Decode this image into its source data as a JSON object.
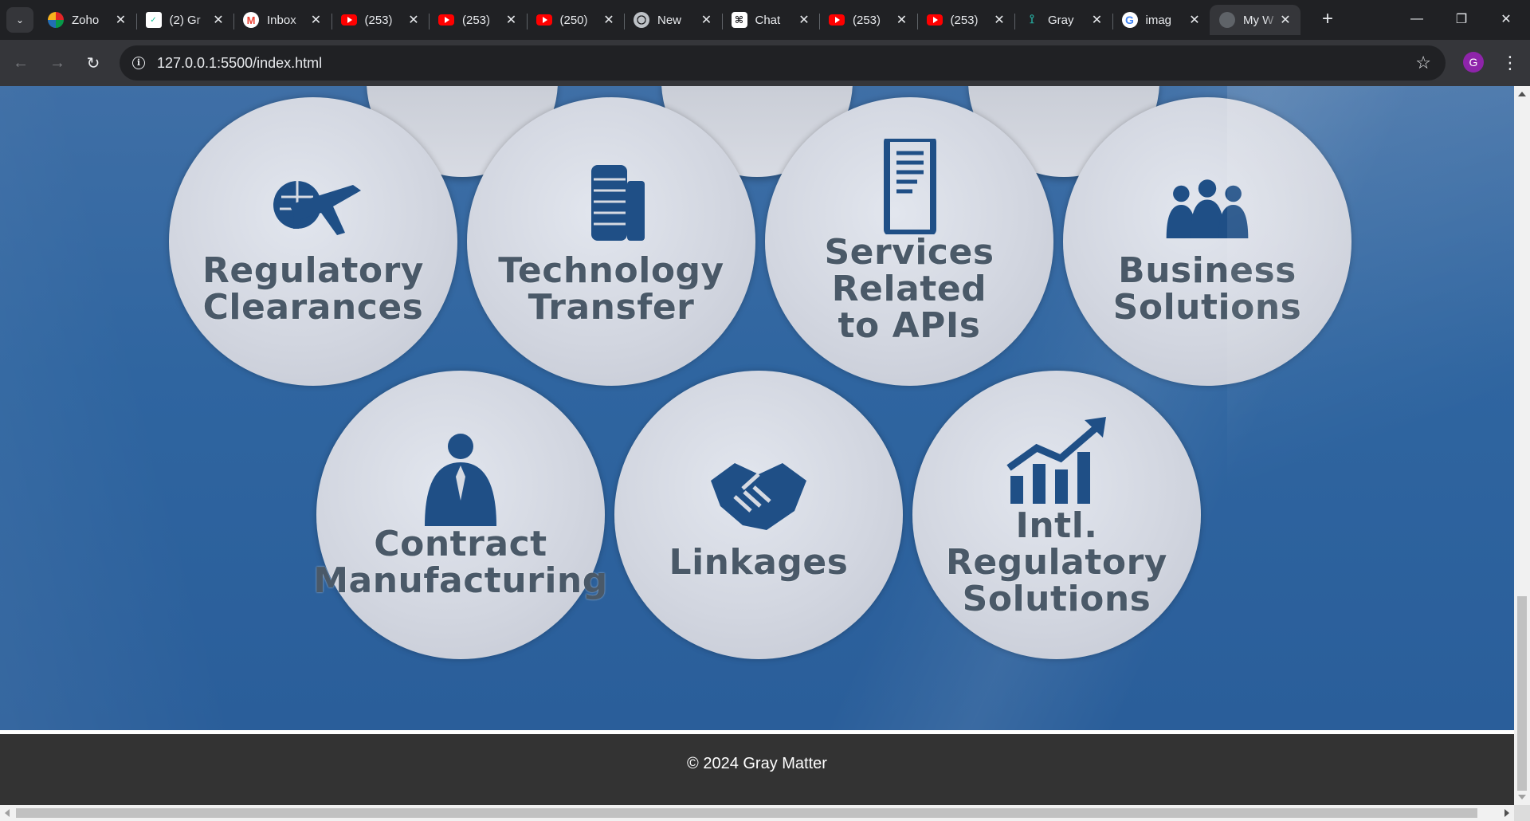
{
  "tabs": [
    {
      "title": "Zoho",
      "icon": "zoho-icon"
    },
    {
      "title": "(2) Gr",
      "icon": "grammarly-icon"
    },
    {
      "title": "Inbox",
      "icon": "gmail-icon"
    },
    {
      "title": "(253)",
      "icon": "youtube-icon"
    },
    {
      "title": "(253)",
      "icon": "youtube-icon"
    },
    {
      "title": "(250)",
      "icon": "youtube-icon"
    },
    {
      "title": "New",
      "icon": "chrome-icon"
    },
    {
      "title": "Chat",
      "icon": "chatgpt-icon"
    },
    {
      "title": "(253)",
      "icon": "youtube-icon"
    },
    {
      "title": "(253)",
      "icon": "youtube-icon"
    },
    {
      "title": "Gray",
      "icon": "gray-matter-icon"
    },
    {
      "title": "imag",
      "icon": "google-icon"
    },
    {
      "title": "My W",
      "icon": "globe-icon",
      "active": true
    }
  ],
  "toolbar": {
    "url": "127.0.0.1:5500/index.html",
    "profile_initial": "G"
  },
  "services": [
    {
      "label": "Regulatory\nClearances",
      "icon": "airplane-globe-icon"
    },
    {
      "label": "Technology\nTransfer",
      "icon": "server-stack-icon"
    },
    {
      "label": "Services\nRelated\nto APIs",
      "icon": "document-icon"
    },
    {
      "label": "Business\nSolutions",
      "icon": "team-icon"
    },
    {
      "label": "Contract\nManufacturing",
      "icon": "businessman-icon"
    },
    {
      "label": "Linkages",
      "icon": "handshake-icon"
    },
    {
      "label": "Intl. Regulatory\nSolutions",
      "icon": "growth-chart-icon"
    }
  ],
  "footer": {
    "text": "© 2024 Gray Matter"
  },
  "colors": {
    "hero_blue": "#2f65a0",
    "icon_blue": "#1f4f86",
    "footer_bg": "#333333"
  }
}
